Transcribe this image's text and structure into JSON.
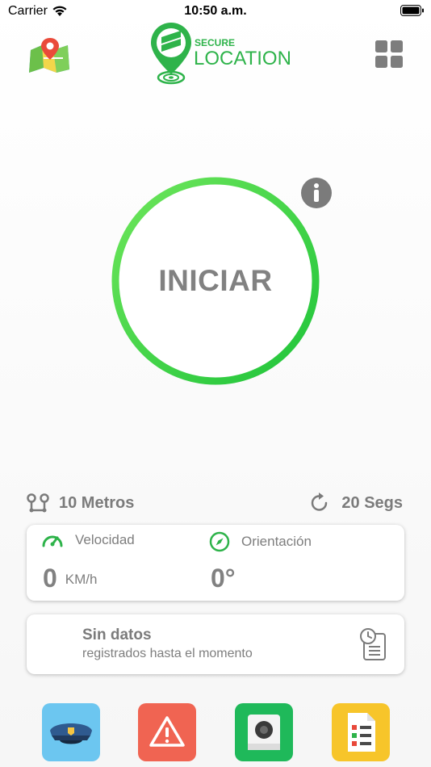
{
  "status_bar": {
    "carrier": "Carrier",
    "time": "10:50 a.m."
  },
  "header": {
    "logo_top": "SECURE",
    "logo_bottom": "LOCATION",
    "left_icon": "map-pin-icon",
    "right_icon": "grid-menu-icon"
  },
  "main_button": {
    "label": "INICIAR",
    "ring_color_start": "#6ee65b",
    "ring_color_end": "#1fc43a"
  },
  "meta": {
    "distance": "10 Metros",
    "interval": "20 Segs"
  },
  "stats": {
    "speed_label": "Velocidad",
    "speed_value": "0",
    "speed_unit": "KM/h",
    "orientation_label": "Orientación",
    "orientation_value": "0°"
  },
  "data_card": {
    "title": "Sin datos",
    "subtitle": "registrados hasta el momento"
  },
  "bottom_tiles": [
    {
      "name": "police",
      "icon": "police-cap-icon",
      "color": "#6cc6f0"
    },
    {
      "name": "alert",
      "icon": "warning-icon",
      "color": "#f06452"
    },
    {
      "name": "camera",
      "icon": "camera-icon",
      "color": "#1fb95a"
    },
    {
      "name": "report",
      "icon": "checklist-icon",
      "color": "#f7c52a"
    }
  ],
  "colors": {
    "brand_green": "#2eb34a",
    "text_gray": "#7b7b7b"
  }
}
